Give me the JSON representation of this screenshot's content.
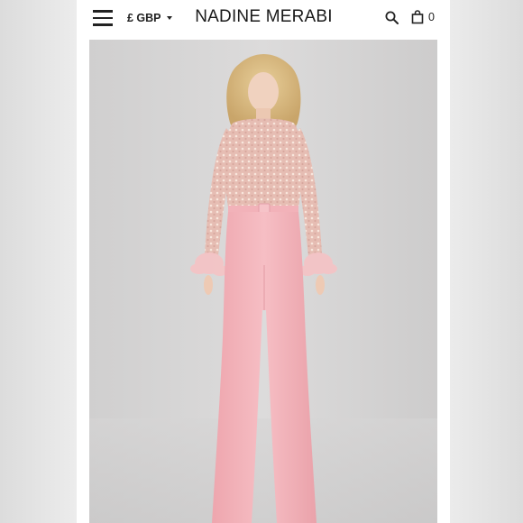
{
  "header": {
    "menu_icon": "hamburger-menu-icon",
    "currency_label": "£ GBP",
    "brand_name": "NADINE MERABI",
    "search_icon": "search-icon",
    "bag_icon": "shopping-bag-icon",
    "bag_count": "0"
  },
  "product_image": {
    "subject": "model wearing pink jumpsuit with embellished bodice and feather cuffs"
  },
  "colors": {
    "background": "#d3d3d3",
    "jumpsuit_pink": "#f3b6bd",
    "bodice": "#e8c1b8",
    "text": "#222222"
  }
}
